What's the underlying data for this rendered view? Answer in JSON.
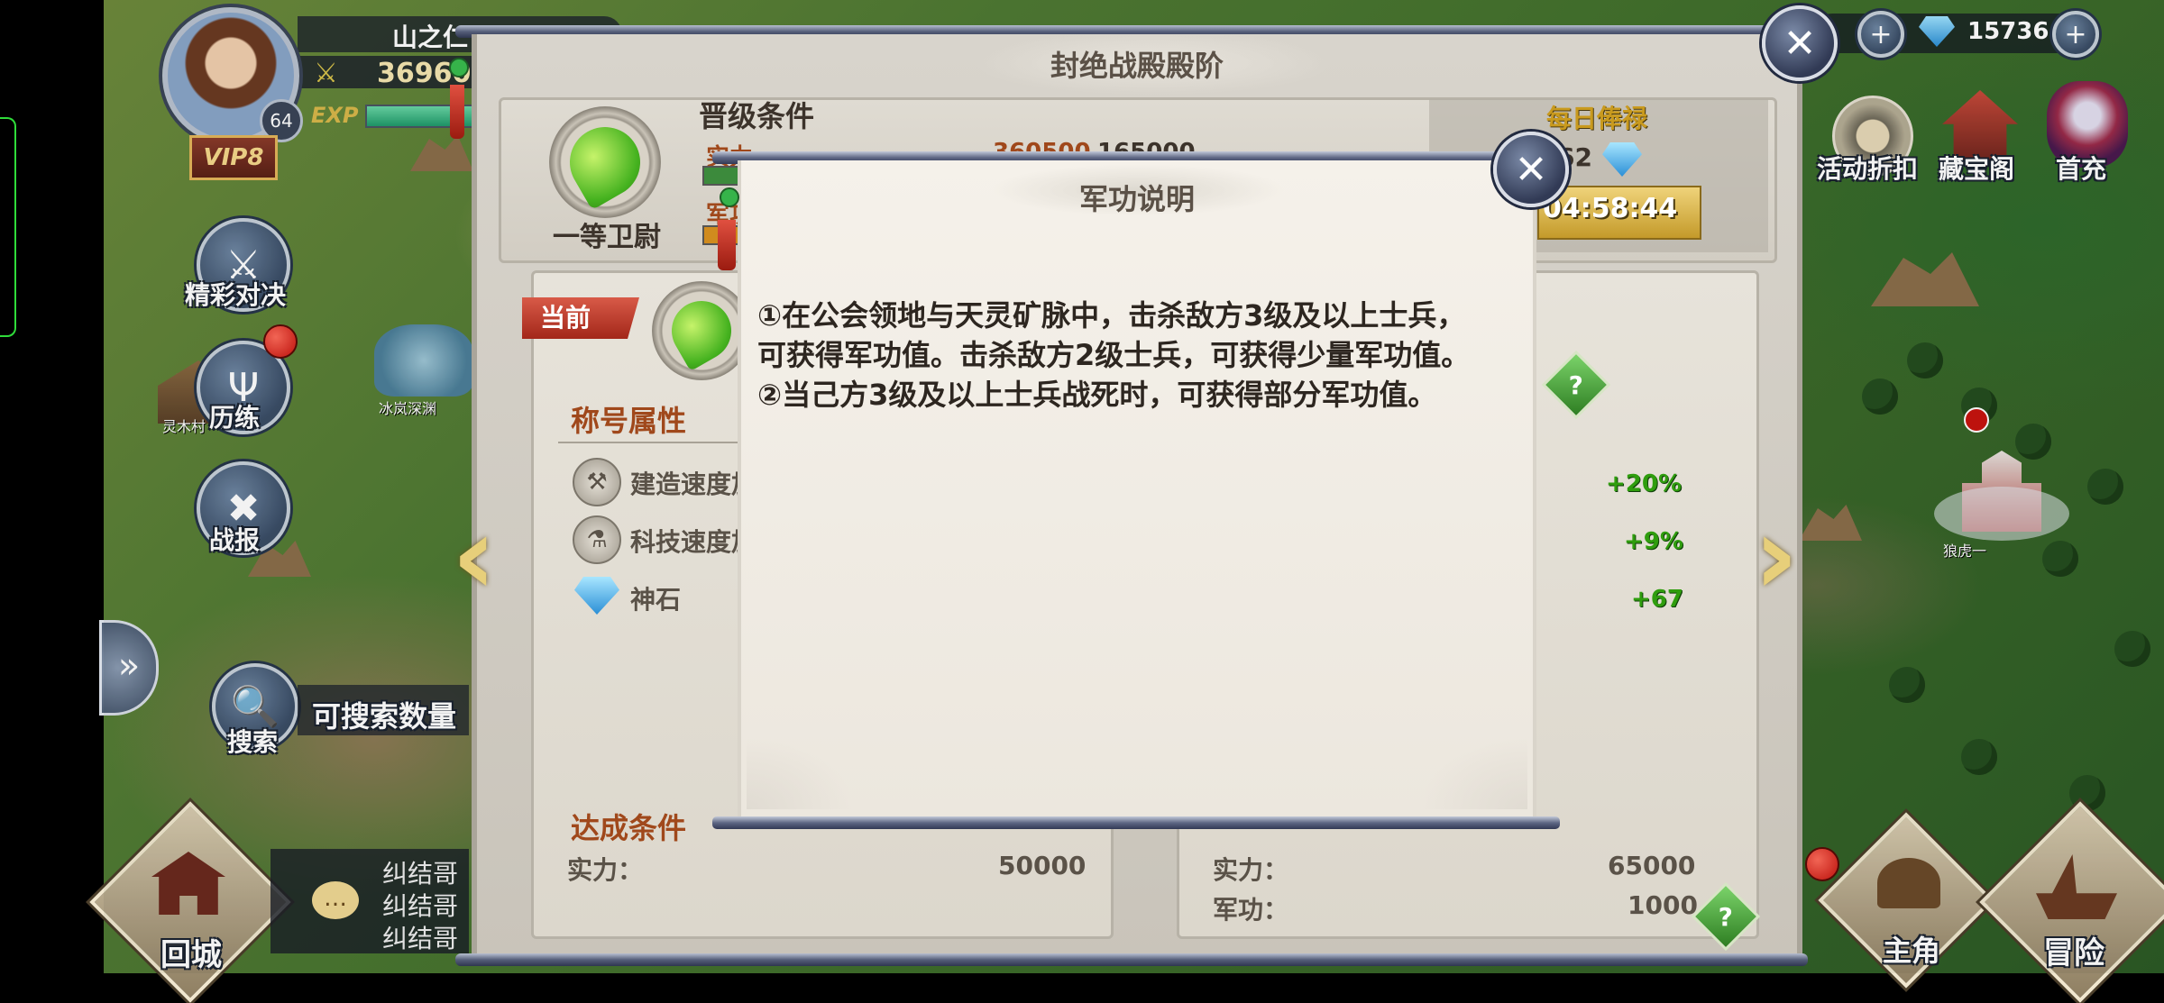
{
  "player": {
    "name": "山之仁",
    "power": "36960",
    "level": "64",
    "exp_label": "EXP",
    "vip": "VIP8"
  },
  "top_bar": {
    "gems": "15736"
  },
  "side_menu": {
    "items": [
      {
        "label": "精彩对决",
        "icon": "crossed-swords-icon"
      },
      {
        "label": "历练",
        "icon": "trident-icon"
      },
      {
        "label": "战报",
        "icon": "battle-report-icon"
      }
    ],
    "search_label": "搜索",
    "search_count_text": "可搜索数量"
  },
  "map_labels": {
    "cave": "冰岚深渊",
    "village": "灵木村",
    "castle": "狼虎一"
  },
  "right_menu": {
    "items": [
      {
        "label": "活动折扣",
        "icon": "discount-icon"
      },
      {
        "label": "藏宝阁",
        "icon": "treasure-pavilion-icon"
      },
      {
        "label": "首充",
        "icon": "first-recharge-icon"
      }
    ]
  },
  "bottom_bar": {
    "return_city": "回城",
    "chat_lines": [
      "纠结哥",
      "纠结哥",
      "纠结哥"
    ],
    "hero": "主角",
    "adventure": "冒险"
  },
  "rank_dialog": {
    "title": "封绝战殿殿阶",
    "rank_name": "一等卫尉",
    "promotion_heading": "晋级条件",
    "promotion_rows": [
      {
        "label": "实力",
        "value": "360500",
        "target": "165000"
      },
      {
        "label": "军功",
        "value": "",
        "target": ""
      }
    ],
    "daily_salary_heading": "每日俸禄",
    "daily_salary_amount": "62",
    "timer": "04:58:44",
    "current_tag": "当前",
    "attr_heading": "称号属性",
    "attributes": [
      {
        "label": "建造速度加成",
        "icon": "hammer-icon",
        "value": "+20%"
      },
      {
        "label": "科技速度加成",
        "icon": "flask-icon",
        "value": "+9%"
      },
      {
        "label": "神石",
        "icon": "gem-icon",
        "value": "+67"
      }
    ],
    "achieve_heading": "达成条件",
    "left_conditions": [
      {
        "label": "实力：",
        "value": "50000"
      }
    ],
    "right_conditions": [
      {
        "label": "实力：",
        "value": "65000"
      },
      {
        "label": "军功：",
        "value": "1000"
      }
    ],
    "help_glyph": "?"
  },
  "merit_popup": {
    "title": "军功说明",
    "lines": [
      "①在公会领地与天灵矿脉中，击杀敌方3级及以上士兵，",
      "可获得军功值。击杀敌方2级士兵，可获得少量军功值。",
      "②当己方3级及以上士兵战死时，可获得部分军功值。"
    ]
  },
  "colors": {
    "accent_brown": "#a0481b",
    "value_green": "#2f9d0e",
    "timer_gold": "#d8b94a",
    "frame_navy": "#313a55"
  }
}
